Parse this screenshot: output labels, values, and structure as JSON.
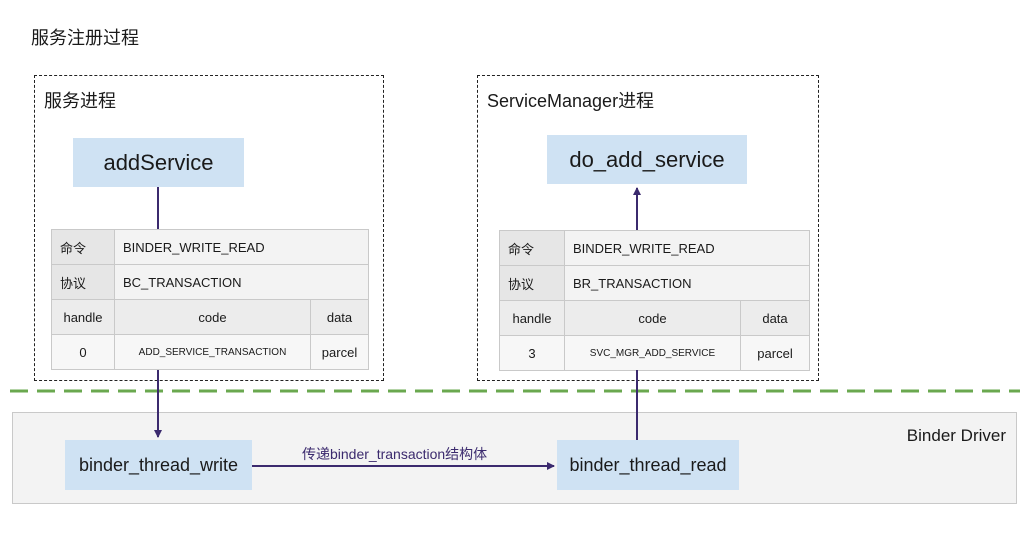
{
  "title": "服务注册过程",
  "client_process": {
    "label": "服务进程",
    "function": "addService",
    "command": {
      "key": "命令",
      "value": "BINDER_WRITE_READ"
    },
    "protocol": {
      "key": "协议",
      "value": "BC_TRANSACTION"
    },
    "headers": [
      "handle",
      "code",
      "data"
    ],
    "row": [
      "0",
      "ADD_SERVICE_TRANSACTION",
      "parcel"
    ]
  },
  "server_process": {
    "label": "ServiceManager进程",
    "function": "do_add_service",
    "command": {
      "key": "命令",
      "value": "BINDER_WRITE_READ"
    },
    "protocol": {
      "key": "协议",
      "value": "BR_TRANSACTION"
    },
    "headers": [
      "handle",
      "code",
      "data"
    ],
    "row": [
      "3",
      "SVC_MGR_ADD_SERVICE",
      "parcel"
    ]
  },
  "driver": {
    "label": "Binder Driver",
    "write_node": "binder_thread_write",
    "read_node": "binder_thread_read",
    "edge_label": "传递binder_transaction结构体"
  },
  "colors": {
    "node_fill": "#cfe2f3",
    "arrow": "#3b2a6e",
    "boundary_dash": "#6aa84f",
    "driver_fill": "#f3f3f3"
  }
}
